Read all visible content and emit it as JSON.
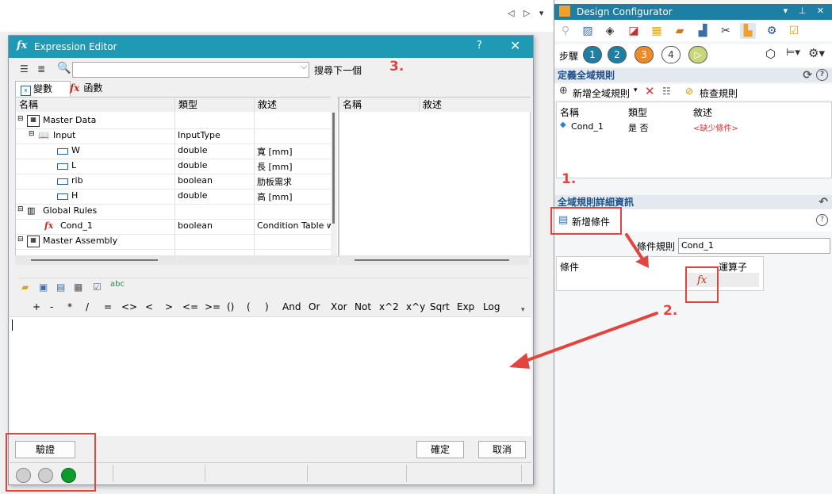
{
  "topnav": {
    "arrows": "◁ ▷ ▾ ✕"
  },
  "expression_editor": {
    "title": "Expression Editor",
    "title_icon": "fx",
    "help_label": "?",
    "close_label": "✕",
    "search_placeholder": "",
    "search_next_label": "搜尋下一個",
    "tabs": [
      {
        "label": "變數",
        "icon": "variables-icon"
      },
      {
        "label": "函數",
        "icon": "fx"
      }
    ],
    "tree_columns": [
      "名稱",
      "類型",
      "敘述"
    ],
    "tree_rows": [
      {
        "name": "Master Data",
        "type": "",
        "desc": ""
      },
      {
        "name": "Input",
        "type": "InputType",
        "desc": ""
      },
      {
        "name": "W",
        "type": "double",
        "desc": "寬 [mm]"
      },
      {
        "name": "L",
        "type": "double",
        "desc": "長 [mm]"
      },
      {
        "name": "rib",
        "type": "boolean",
        "desc": "肋板需求"
      },
      {
        "name": "H",
        "type": "double",
        "desc": "高 [mm]"
      },
      {
        "name": "Global Rules",
        "type": "",
        "desc": ""
      },
      {
        "name": "Cond_1",
        "type": "boolean",
        "desc": "Condition Table w"
      },
      {
        "name": "Master Assembly",
        "type": "",
        "desc": ""
      }
    ],
    "right_columns": [
      "名稱",
      "敘述"
    ],
    "operators": [
      "+",
      "-",
      "*",
      "/",
      "=",
      "<>",
      "<",
      ">",
      "<=",
      ">=",
      "()",
      "(",
      ")",
      "And",
      "Or",
      "Xor",
      "Not",
      "x^2",
      "x^y",
      "Sqrt",
      "Exp",
      "Log"
    ],
    "expression_text": "",
    "validate_label": "驗證",
    "ok_label": "確定",
    "cancel_label": "取消",
    "status_colors": [
      "#cfcfcf",
      "#cfcfcf",
      "#0e9a2d"
    ]
  },
  "annotations": {
    "one": "1.",
    "two": "2.",
    "three": "3."
  },
  "design_configurator": {
    "title": "Design Configurator",
    "title_controls": "▾ ⊥ ✕",
    "steps_label": "步驟",
    "steps": [
      {
        "label": "1",
        "color": "#1e7fa5"
      },
      {
        "label": "2",
        "color": "#1e7fa5"
      },
      {
        "label": "3",
        "color": "#f08a24"
      },
      {
        "label": "4",
        "color": "#ffffff"
      },
      {
        "label": "▷",
        "color": "#c9d67a"
      }
    ],
    "define_rules_title": "定義全域規則",
    "add_rule_label": "新增全域規則",
    "check_rules_label": "檢查規則",
    "grid_columns": [
      "名稱",
      "類型",
      "敘述"
    ],
    "grid_rows": [
      {
        "name": "Cond_1",
        "type": "是 否",
        "desc": "<缺少條件>"
      }
    ],
    "detail_title": "全域規則詳細資訊",
    "add_condition_label": "新增條件",
    "rule_label": "條件規則",
    "rule_value": "Cond_1",
    "cond_columns": [
      "條件",
      "運算子"
    ],
    "fx_label": "fx"
  }
}
